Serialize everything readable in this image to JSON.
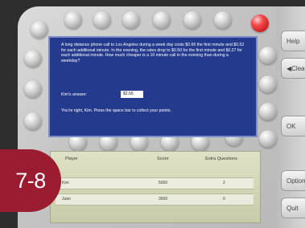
{
  "question": {
    "text": "A long distance phone call to Los Angeles during a week day costs $0.66 the first minute and $0.52 for each additional minute. In the evening, the rates drop to $0.50 for the first minute and $0.27 for each additional minute. How much cheaper is a 10 minute call in the evening than during a weekday?",
    "answer_label": "Kim's answer:",
    "answer_value": "$2.65",
    "feedback": "You're right, Kim. Press the space bar to collect your points."
  },
  "side_buttons": [
    "Help",
    "Clear",
    "OK",
    "Options",
    "Quit"
  ],
  "scores": {
    "headers": [
      "Player",
      "Score",
      "Extra Questions"
    ],
    "rows": [
      {
        "player": "Kim",
        "score": "5000",
        "extra": "2"
      },
      {
        "player": "Juan",
        "score": "3000",
        "extra": "0"
      }
    ]
  },
  "badge": {
    "label": "7-8",
    "color": "#9b1b30"
  },
  "colors": {
    "question_panel": "#243a8c",
    "score_panel": "#d7dabc",
    "alert_stud": "#e83030"
  }
}
